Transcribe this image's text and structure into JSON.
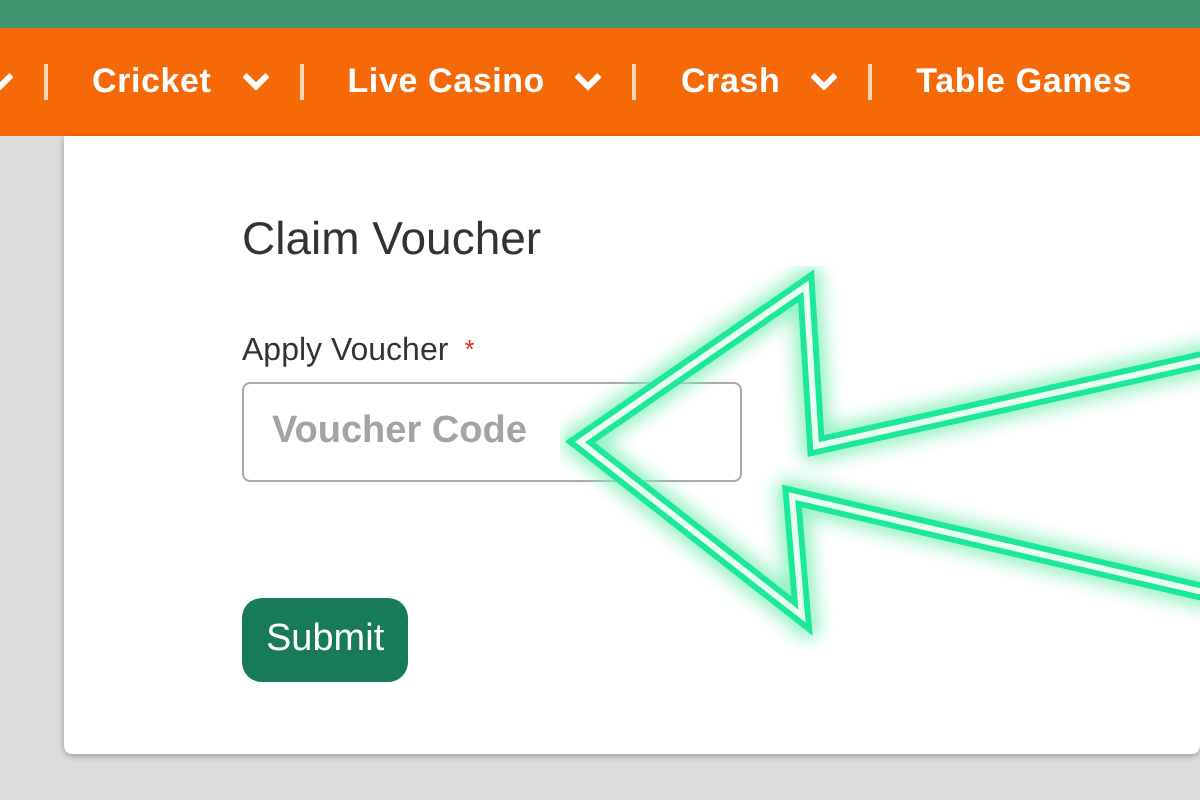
{
  "nav": {
    "items": [
      {
        "kind": "chevron-only",
        "dropdown": true
      },
      {
        "kind": "menu",
        "label": "Cricket",
        "dropdown": true
      },
      {
        "kind": "menu",
        "label": "Live Casino",
        "dropdown": true
      },
      {
        "kind": "menu",
        "label": "Crash",
        "dropdown": true
      },
      {
        "kind": "menu",
        "label": "Table Games",
        "dropdown": false
      }
    ]
  },
  "form": {
    "title": "Claim Voucher",
    "field_label": "Apply Voucher",
    "required_mark": "*",
    "placeholder": "Voucher Code",
    "submit": "Submit"
  }
}
